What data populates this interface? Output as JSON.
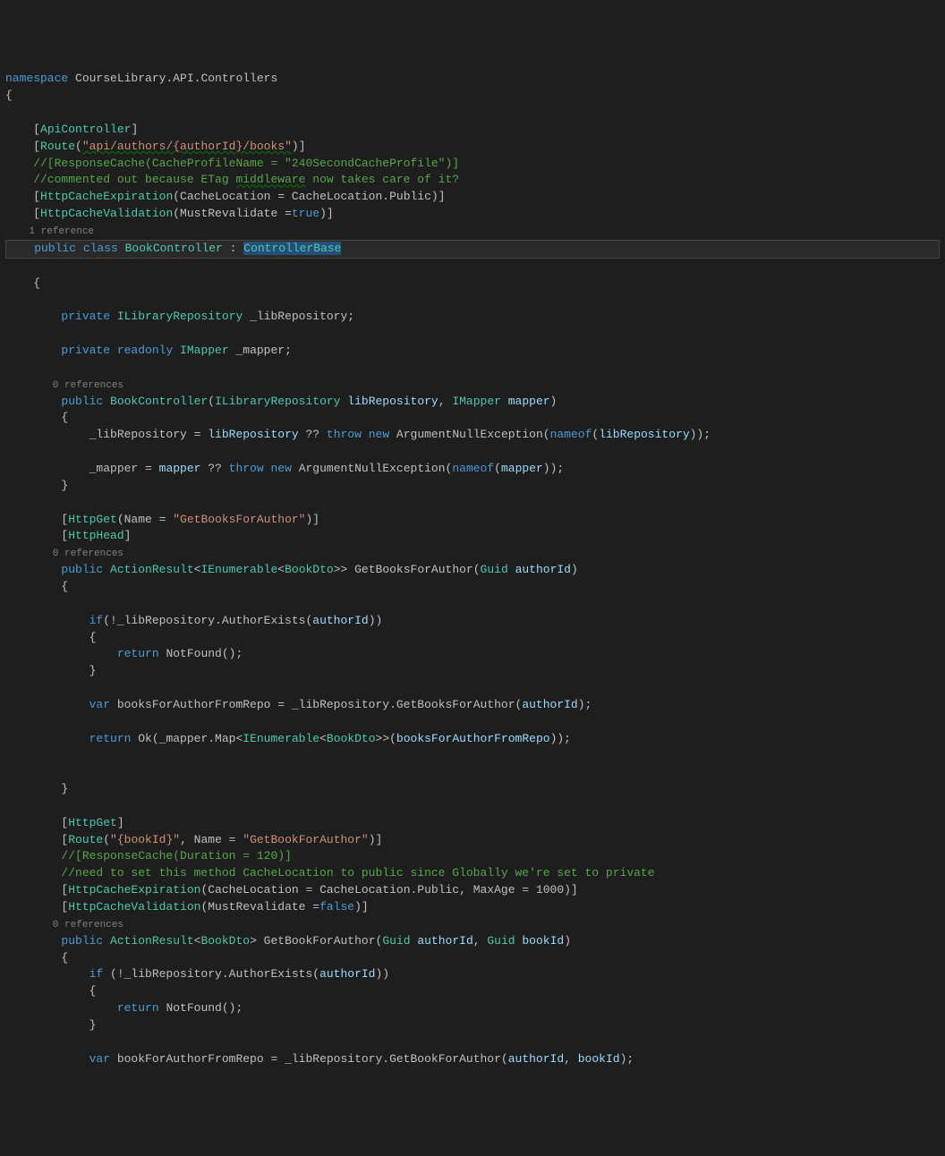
{
  "code": {
    "ns_kw": "namespace",
    "ns_name": " CourseLibrary.API.Controllers",
    "obrace": "{",
    "attr_apictrl_open": "    [",
    "attr_apictrl": "ApiController",
    "attr_apictrl_close": "]",
    "attr_route_open": "    [",
    "attr_route": "Route",
    "attr_route_p1": "(",
    "attr_route_str": "\"api/authors/{authorId}/books\"",
    "attr_route_p2": ")]",
    "cmt_respcache": "    //[ResponseCache(CacheProfileName = \"240SecondCacheProfile\")]",
    "cmt_etag": "    //commented out because ETag ",
    "cmt_etag_mid": "middleware",
    "cmt_etag_tail": " now takes care of it?",
    "attr_hce_open": "    [",
    "attr_hce": "HttpCacheExpiration",
    "attr_hce_body": "(CacheLocation = CacheLocation.Public)]",
    "attr_hcv_open": "    [",
    "attr_hcv": "HttpCacheValidation",
    "attr_hcv_body1": "(MustRevalidate =",
    "attr_hcv_true": "true",
    "attr_hcv_body2": ")]",
    "ref1": "    1 reference",
    "cls_pub": "    public",
    "cls_cls": " class",
    "cls_name": " BookController",
    "cls_colon": " : ",
    "cls_base": "ControllerBase",
    "cls_obrace": "    {",
    "fld1_priv": "        private",
    "fld1_type": " ILibraryRepository",
    "fld1_name": " _libRepository;",
    "fld2_priv": "        private",
    "fld2_ro": " readonly",
    "fld2_type": " IMapper",
    "fld2_name": " _mapper;",
    "ref0a": "        0 references",
    "ctor_pub": "        public",
    "ctor_name": " BookController",
    "ctor_p1": "(",
    "ctor_pt1": "ILibraryRepository",
    "ctor_pn1": " libRepository",
    "ctor_comma": ", ",
    "ctor_pt2": "IMapper",
    "ctor_pn2": " mapper",
    "ctor_p2": ")",
    "ctor_obrace": "        {",
    "ctor_l1a": "            _libRepository = ",
    "ctor_l1b": "libRepository",
    "ctor_l1c": " ?? ",
    "ctor_l1_throw": "throw",
    "ctor_l1_sp": " ",
    "ctor_l1_new": "new",
    "ctor_l1d": " ArgumentNullException",
    "ctor_l1e": "(",
    "ctor_l1_nameof": "nameof",
    "ctor_l1f": "(",
    "ctor_l1g": "libRepository",
    "ctor_l1h": "));",
    "ctor_blank": "",
    "ctor_l2a": "            _mapper = ",
    "ctor_l2b": "mapper",
    "ctor_l2c": " ?? ",
    "ctor_l2_throw": "throw",
    "ctor_l2_sp": " ",
    "ctor_l2_new": "new",
    "ctor_l2d": " ArgumentNullException",
    "ctor_l2e": "(",
    "ctor_l2_nameof": "nameof",
    "ctor_l2f": "(",
    "ctor_l2g": "mapper",
    "ctor_l2h": "));",
    "ctor_cbrace": "        }",
    "m1_attr1_open": "        [",
    "m1_attr1": "HttpGet",
    "m1_attr1_body1": "(Name = ",
    "m1_attr1_str": "\"GetBooksForAuthor\"",
    "m1_attr1_body2": ")]",
    "m1_attr2_open": "        [",
    "m1_attr2": "HttpHead",
    "m1_attr2_close": "]",
    "ref0b": "        0 references",
    "m1_pub": "        public",
    "m1_ret": " ActionResult",
    "m1_g1": "<",
    "m1_ien": "IEnumerable",
    "m1_g2": "<",
    "m1_dto": "BookDto",
    "m1_g3": ">>",
    "m1_mname": " GetBooksForAuthor(",
    "m1_ptype": "Guid",
    "m1_pname": " authorId",
    "m1_close": ")",
    "m1_obrace": "        {",
    "m1_blank1": "",
    "m1_if": "            if",
    "m1_ifc": "(!_libRepository.AuthorExists(",
    "m1_ifp": "authorId",
    "m1_ifd": "))",
    "m1_ifob": "            {",
    "m1_ret1": "                return",
    "m1_ret1b": " NotFound();",
    "m1_ifcb": "            }",
    "m1_blank2": "",
    "m1_var": "            var",
    "m1_varname": " booksForAuthorFromRepo = _libRepository.GetBooksForAuthor(",
    "m1_varp": "authorId",
    "m1_varc": ");",
    "m1_blank3": "",
    "m1_ret2": "            return",
    "m1_ret2b": " Ok(_mapper.Map<",
    "m1_ret2_ien": "IEnumerable",
    "m1_ret2c": "<",
    "m1_ret2_dto": "BookDto",
    "m1_ret2d": ">>(",
    "m1_ret2e": "booksForAuthorFromRepo",
    "m1_ret2f": "));",
    "m1_blank4": "",
    "m1_blank5": "",
    "m1_cbrace": "        }",
    "m2_attr1_open": "        [",
    "m2_attr1": "HttpGet",
    "m2_attr1_close": "]",
    "m2_attr2_open": "        [",
    "m2_attr2": "Route",
    "m2_attr2_p1": "(",
    "m2_attr2_s1": "\"{bookId}\"",
    "m2_attr2_mid": ", Name = ",
    "m2_attr2_s2": "\"GetBookForAuthor\"",
    "m2_attr2_p2": ")]",
    "m2_cmt1": "        //[ResponseCache(Duration = 120)]",
    "m2_cmt2": "        //need to set this method CacheLocation to public since Globally we're set to private",
    "m2_attr3_open": "        [",
    "m2_attr3": "HttpCacheExpiration",
    "m2_attr3_body": "(CacheLocation = CacheLocation.Public, MaxAge = 1000)]",
    "m2_attr4_open": "        [",
    "m2_attr4": "HttpCacheValidation",
    "m2_attr4_b1": "(MustRevalidate =",
    "m2_attr4_false": "false",
    "m2_attr4_b2": ")]",
    "ref0c": "        0 references",
    "m2_pub": "        public",
    "m2_ret": " ActionResult",
    "m2_g1": "<",
    "m2_dto": "BookDto",
    "m2_g2": ">",
    "m2_mname": " GetBookForAuthor(",
    "m2_pt1": "Guid",
    "m2_pn1": " authorId",
    "m2_comma": ", ",
    "m2_pt2": "Guid",
    "m2_pn2": " bookId",
    "m2_close": ")",
    "m2_obrace": "        {",
    "m2_if": "            if",
    "m2_ifc": " (!_libRepository.AuthorExists(",
    "m2_ifp": "authorId",
    "m2_ifd": "))",
    "m2_ifob": "            {",
    "m2_ret1": "                return",
    "m2_ret1b": " NotFound();",
    "m2_ifcb": "            }",
    "m2_blank": "",
    "m2_var": "            var",
    "m2_varname": " bookForAuthorFromRepo = _libRepository.GetBookForAuthor(",
    "m2_varp1": "authorId",
    "m2_varcomma": ", ",
    "m2_varp2": "bookId",
    "m2_varc": ");"
  }
}
